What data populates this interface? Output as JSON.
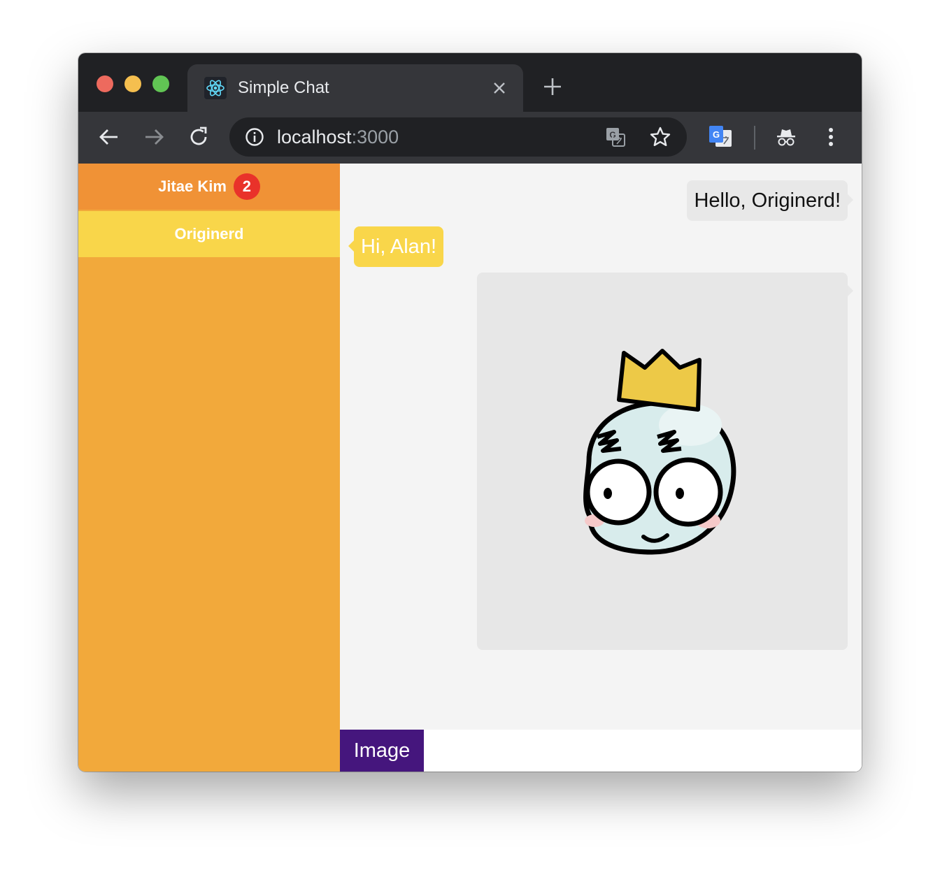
{
  "browser": {
    "tab_title": "Simple Chat",
    "url_host": "localhost",
    "url_port": ":3000"
  },
  "sidebar": {
    "contacts": [
      {
        "name": "Jitae Kim",
        "unread": "2"
      },
      {
        "name": "Originerd"
      }
    ]
  },
  "chat": {
    "messages": [
      {
        "direction": "outgoing",
        "text": "Hello, Originerd!"
      },
      {
        "direction": "incoming",
        "text": "Hi, Alan!"
      },
      {
        "direction": "outgoing",
        "type": "image",
        "image": "crown-face-sticker"
      }
    ]
  },
  "composer": {
    "image_button_label": "Image",
    "input_value": ""
  },
  "colors": {
    "sidebar": "#f2a93b",
    "active_contact": "#f09236",
    "selected_contact": "#f9d64a",
    "badge": "#e9322a",
    "image_button": "#45167d",
    "incoming_bubble": "#f9d64a",
    "outgoing_bubble": "#e8e8e8"
  }
}
